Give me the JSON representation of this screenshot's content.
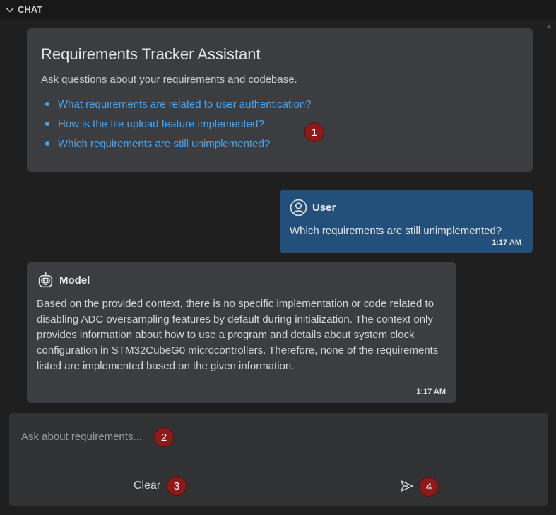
{
  "panel": {
    "title": "CHAT"
  },
  "welcome": {
    "title": "Requirements Tracker Assistant",
    "description": "Ask questions about your requirements and codebase.",
    "suggestions": [
      "What requirements are related to user authentication?",
      "How is the file upload feature implemented?",
      "Which requirements are still unimplemented?"
    ]
  },
  "messages": {
    "user": {
      "sender": "User",
      "text": "Which requirements are still unimplemented?",
      "time": "1:17 AM"
    },
    "model": {
      "sender": "Model",
      "text": "Based on the provided context, there is no specific implementation or code related to disabling ADC oversampling features by default during initialization. The context only provides information about how to use a program and details about system clock configuration in STM32CubeG0 microcontrollers. Therefore, none of the requirements listed are implemented based on the given information.",
      "time": "1:17 AM"
    }
  },
  "input": {
    "placeholder": "Ask about requirements...",
    "value": "",
    "clear_label": "Clear",
    "send_icon": "send-icon"
  },
  "markers": [
    "1",
    "2",
    "3",
    "4"
  ],
  "colors": {
    "accent_link": "#4aa3ef",
    "user_bubble": "#234f7b",
    "card_bg": "#3b3d41",
    "marker": "#8b1a1a"
  }
}
